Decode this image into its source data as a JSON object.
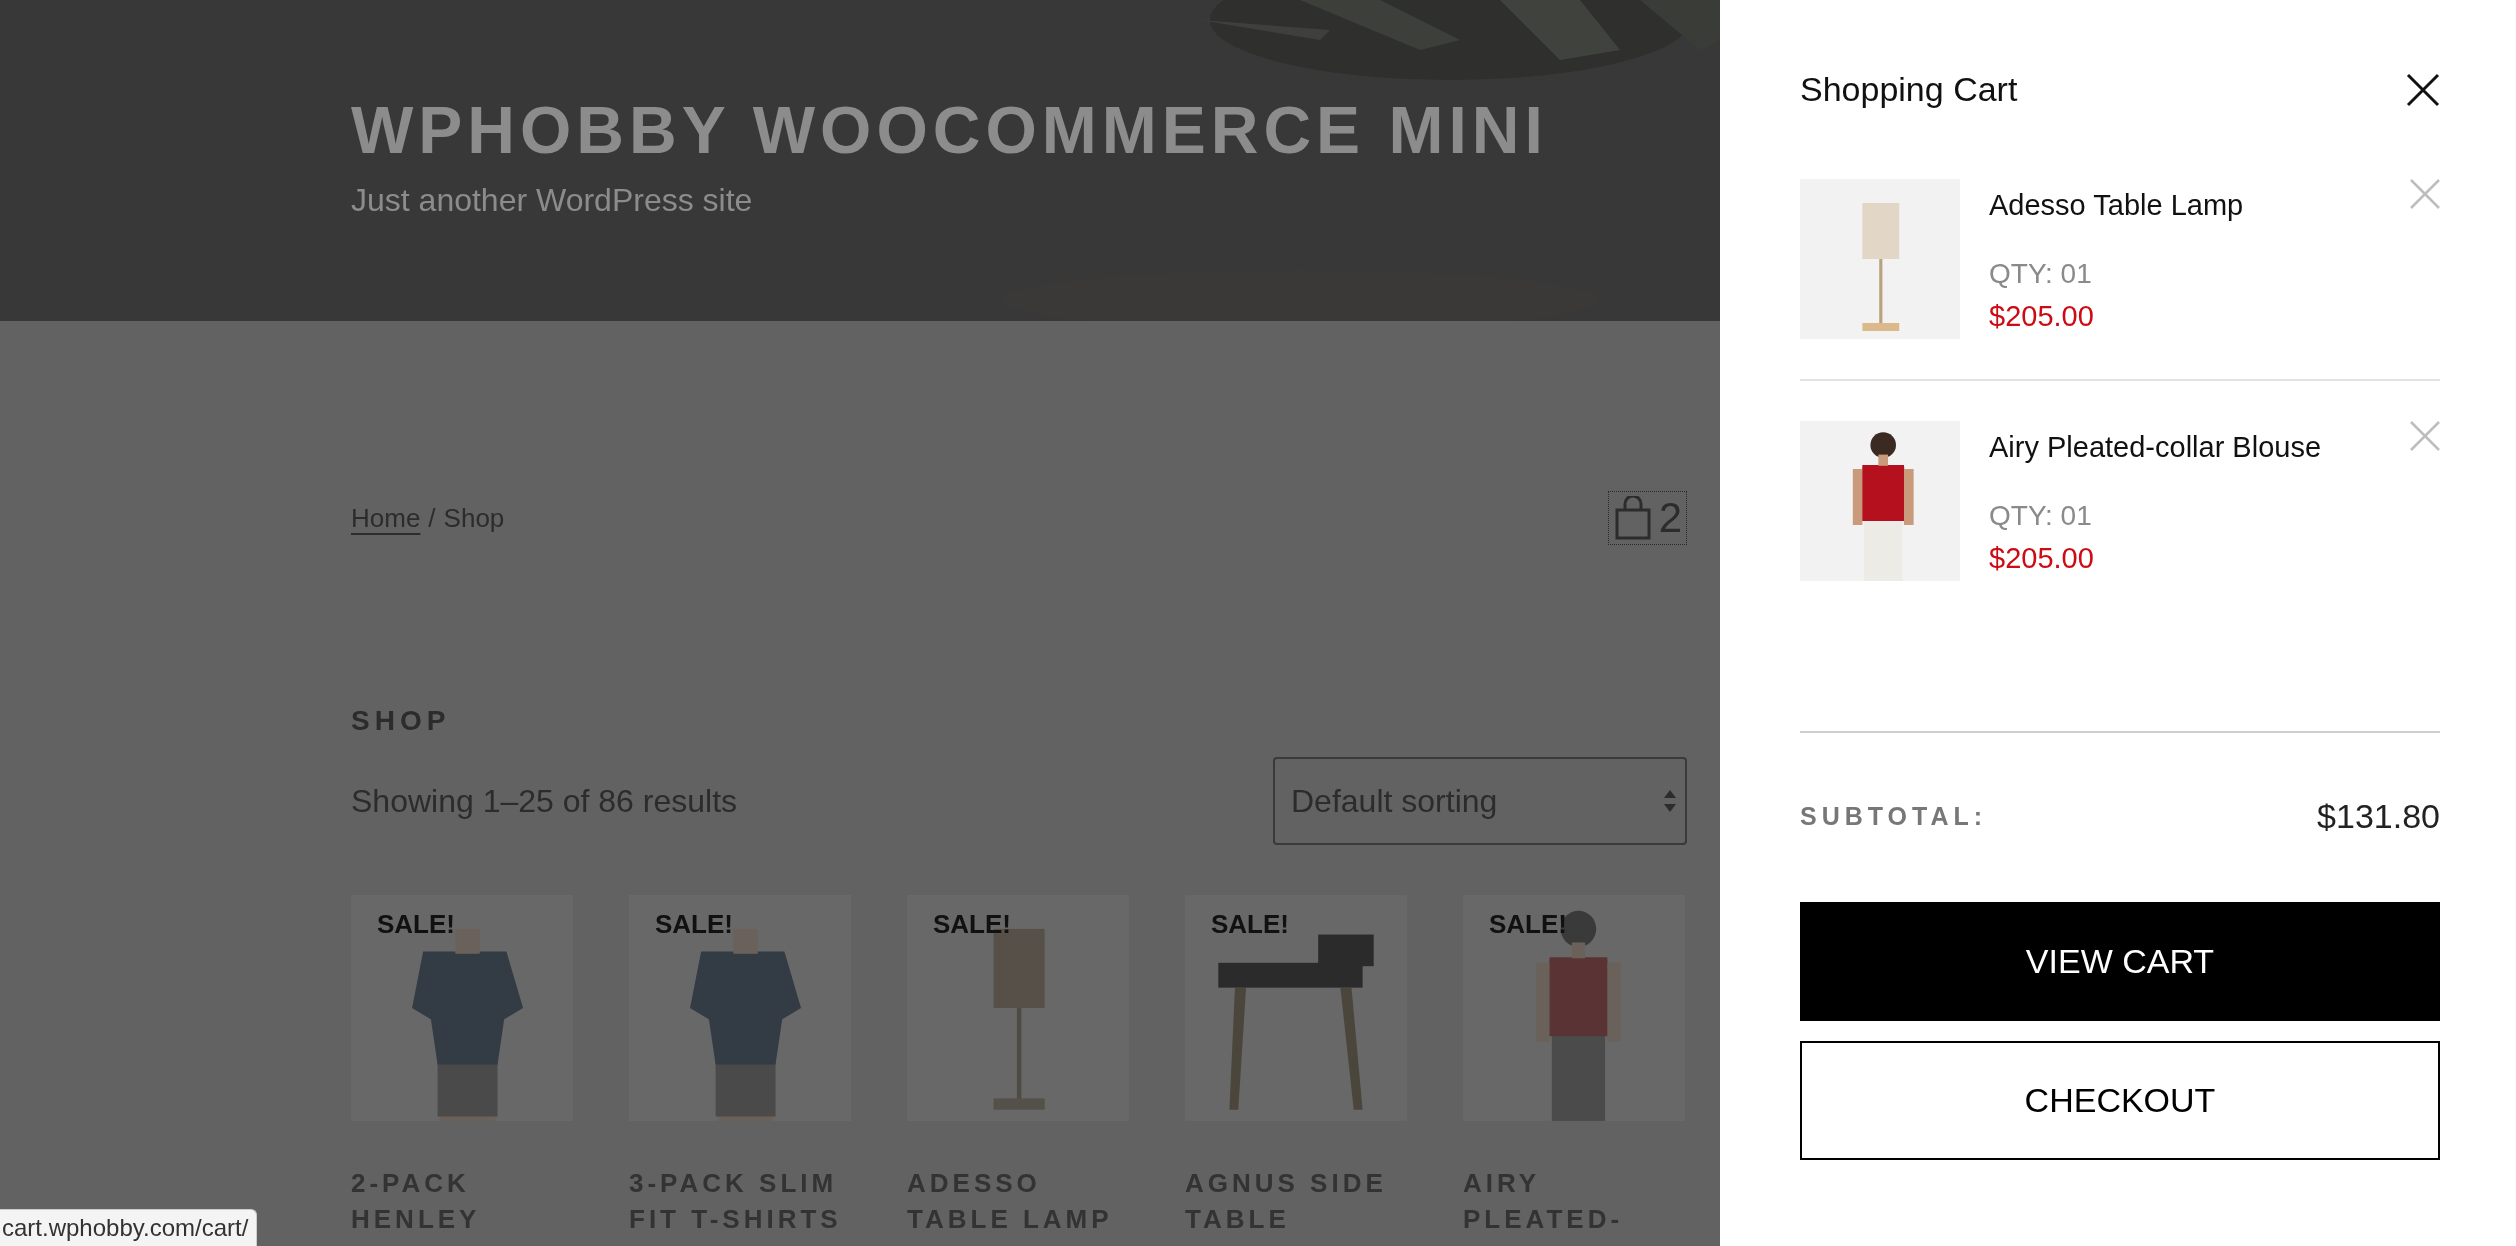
{
  "site": {
    "title": "WPHOBBY WOOCOMMERCE MINI",
    "tagline": "Just another WordPress site"
  },
  "breadcrumb": {
    "links": [
      "Home"
    ],
    "separator": "/",
    "current": "Shop"
  },
  "header_cart": {
    "count": "2"
  },
  "shop": {
    "title": "SHOP",
    "result_count": "Showing 1–25 of 86 results",
    "sort": {
      "value": "Default sorting"
    }
  },
  "products": [
    {
      "name": "2-PACK HENLEY",
      "badge": "SALE!",
      "kind": "shirt"
    },
    {
      "name": "3-PACK SLIM FIT T-SHIRTS",
      "badge": "SALE!",
      "kind": "shirt"
    },
    {
      "name": "ADESSO TABLE LAMP",
      "badge": "SALE!",
      "kind": "lamp"
    },
    {
      "name": "AGNUS SIDE TABLE",
      "badge": "SALE!",
      "kind": "table"
    },
    {
      "name": "AIRY PLEATED-",
      "badge": "SALE!",
      "kind": "blouse"
    }
  ],
  "cart_panel": {
    "title": "Shopping Cart",
    "items": [
      {
        "name": "Adesso Table Lamp",
        "qty": "QTY: 01",
        "price": "$205.00",
        "kind": "lamp"
      },
      {
        "name": "Airy Pleated-collar Blouse",
        "qty": "QTY: 01",
        "price": "$205.00",
        "kind": "blouse"
      }
    ],
    "subtotal": {
      "label": "SUBTOTAL:",
      "value": "$131.80"
    },
    "buttons": [
      {
        "label": "VIEW CART",
        "kind": "primary"
      },
      {
        "label": "CHECKOUT",
        "kind": "secondary"
      }
    ]
  },
  "status_bar": {
    "url": "cart.wphobby.com/cart/"
  }
}
